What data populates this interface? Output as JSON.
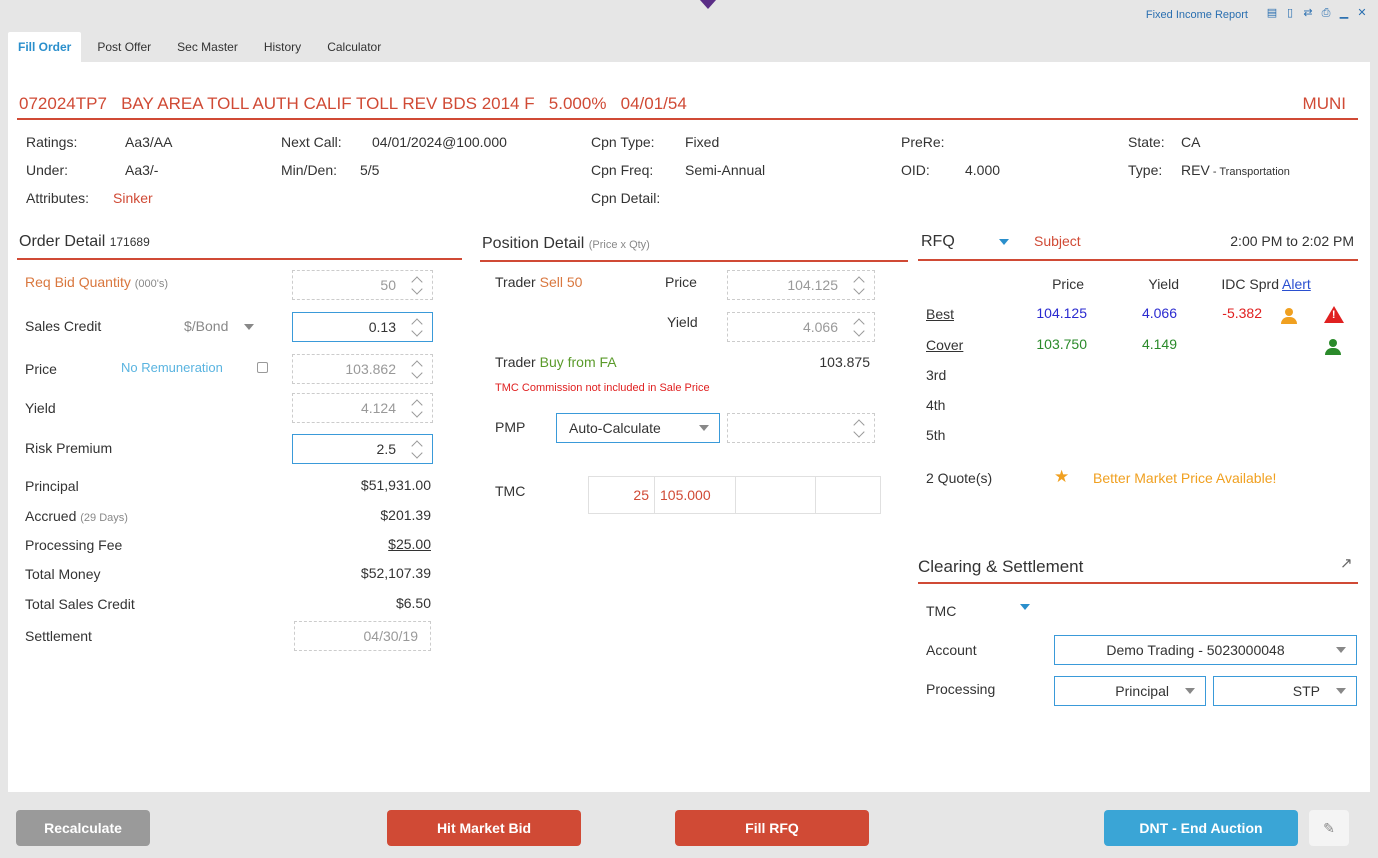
{
  "window": {
    "title": "Fixed Income Report",
    "icons": [
      "menu-icon",
      "mobile-icon",
      "transfer-icon",
      "print-icon",
      "minimize-icon",
      "close-icon"
    ]
  },
  "tabs": [
    {
      "label": "Fill Order",
      "active": true
    },
    {
      "label": "Post Offer"
    },
    {
      "label": "Sec Master"
    },
    {
      "label": "History"
    },
    {
      "label": "Calculator"
    }
  ],
  "security": {
    "header": "072024TP7   BAY AREA TOLL AUTH CALIF TOLL REV BDS 2014 F   5.000%   04/01/54",
    "type_badge": "MUNI",
    "ratings_label": "Ratings:",
    "ratings": "Aa3/AA",
    "under_label": "Under:",
    "under": "Aa3/-",
    "attributes_label": "Attributes:",
    "attributes": "Sinker",
    "next_call_label": "Next Call:",
    "next_call": "04/01/2024@100.000",
    "min_den_label": "Min/Den:",
    "min_den": "5/5",
    "cpn_type_label": "Cpn Type:",
    "cpn_type": "Fixed",
    "cpn_freq_label": "Cpn Freq:",
    "cpn_freq": "Semi-Annual",
    "cpn_detail_label": "Cpn Detail:",
    "prere_label": "PreRe:",
    "oid_label": "OID:",
    "oid": "4.000",
    "state_label": "State:",
    "state": "CA",
    "type_label": "Type:",
    "type": "REV",
    "type_detail": " - Transportation"
  },
  "order_detail": {
    "title": "Order Detail",
    "id": "171689",
    "req_bid_label": "Req Bid Quantity",
    "req_bid_unit": "(000's)",
    "req_bid": "50",
    "sales_credit_label": "Sales Credit",
    "sales_credit_unit": "$/Bond",
    "sales_credit": "0.13",
    "price_label": "Price",
    "no_remuneration": "No Remuneration",
    "price": "103.862",
    "yield_label": "Yield",
    "yield": "4.124",
    "risk_premium_label": "Risk Premium",
    "risk_premium": "2.5",
    "principal_label": "Principal",
    "principal": "$51,931.00",
    "accrued_label": "Accrued",
    "accrued_days": "(29 Days)",
    "accrued": "$201.39",
    "processing_fee_label": "Processing Fee",
    "processing_fee": "$25.00",
    "total_money_label": "Total Money",
    "total_money": "$52,107.39",
    "total_sales_credit_label": "Total Sales Credit",
    "total_sales_credit": "$6.50",
    "settlement_label": "Settlement",
    "settlement": "04/30/19"
  },
  "position_detail": {
    "title": "Position Detail",
    "subtitle": "(Price x Qty)",
    "trader1_label": "Trader",
    "trader1_action": "Sell 50",
    "price_label": "Price",
    "price": "104.125",
    "yield_label": "Yield",
    "yield": "4.066",
    "trader2_label": "Trader",
    "trader2_action": "Buy from FA",
    "trader2_value": "103.875",
    "tmc_note": "TMC Commission not included in Sale Price",
    "pmp_label": "PMP",
    "pmp_mode": "Auto-Calculate",
    "tmc_label": "TMC",
    "tmc_qty": "25",
    "tmc_price": "105.000"
  },
  "rfq": {
    "title": "RFQ",
    "status": "Subject",
    "time_range": "2:00 PM to 2:02 PM",
    "col_price": "Price",
    "col_yield": "Yield",
    "col_idc": "IDC Sprd",
    "col_alert": "Alert",
    "rows": [
      {
        "label": "Best",
        "price": "104.125",
        "yield": "4.066",
        "idc": "-5.382"
      },
      {
        "label": "Cover",
        "price": "103.750",
        "yield": "4.149",
        "idc": ""
      },
      {
        "label": "3rd",
        "price": "",
        "yield": "",
        "idc": ""
      },
      {
        "label": "4th",
        "price": "",
        "yield": "",
        "idc": ""
      },
      {
        "label": "5th",
        "price": "",
        "yield": "",
        "idc": ""
      }
    ],
    "quotes": "2 Quote(s)",
    "better_price": "Better Market Price Available!"
  },
  "clearing": {
    "title": "Clearing & Settlement",
    "tmc_label": "TMC",
    "account_label": "Account",
    "account": "Demo Trading - 5023000048",
    "processing_label": "Processing",
    "processing": "Principal",
    "processing_mode": "STP"
  },
  "buttons": {
    "recalculate": "Recalculate",
    "hit_market_bid": "Hit Market Bid",
    "fill_rfq": "Fill RFQ",
    "dnt_end_auction": "DNT - End Auction"
  },
  "colors": {
    "accent_red": "#d04a35",
    "accent_blue": "#2a8fcc",
    "button_grey": "#9a9a9a",
    "button_blue": "#3aa5d6"
  }
}
